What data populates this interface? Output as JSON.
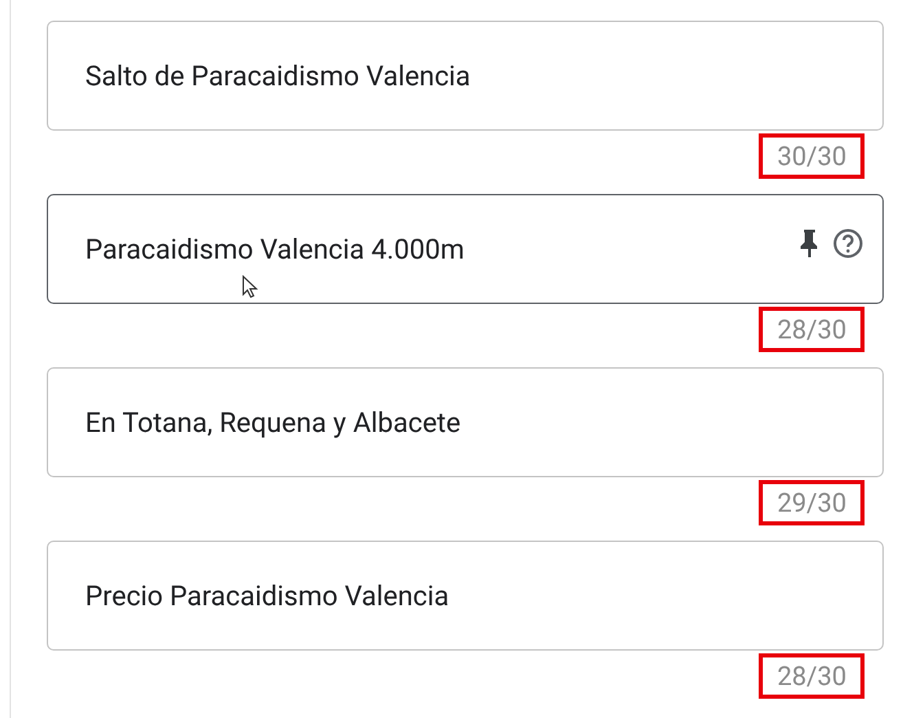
{
  "fields": [
    {
      "value": "Salto de Paracaidismo Valencia",
      "counter": "30/30",
      "hovered": false
    },
    {
      "value": "Paracaidismo Valencia 4.000m",
      "counter": "28/30",
      "hovered": true
    },
    {
      "value": "En Totana, Requena y Albacete",
      "counter": "29/30",
      "hovered": false
    },
    {
      "value": "Precio Paracaidismo Valencia",
      "counter": "28/30",
      "hovered": false
    }
  ]
}
